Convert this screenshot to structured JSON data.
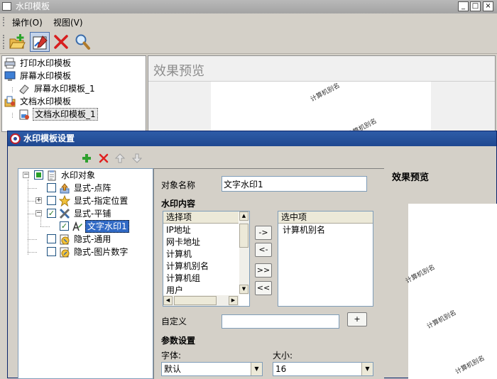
{
  "main_window": {
    "title": "水印模板",
    "controls": {
      "minimize": "_",
      "maximize": "□",
      "close": "×"
    }
  },
  "menu": {
    "items": [
      {
        "label": "操作(O)"
      },
      {
        "label": "视图(V)"
      }
    ]
  },
  "toolbar": {
    "buttons": [
      {
        "icon": "open-folder-add-icon"
      },
      {
        "icon": "edit-template-icon",
        "active": true
      },
      {
        "icon": "delete-x-icon"
      },
      {
        "icon": "magnifier-search-icon"
      }
    ]
  },
  "template_tree": {
    "items": [
      {
        "label": "打印水印模板",
        "icon": "printer-icon"
      },
      {
        "label": "屏幕水印模板",
        "icon": "monitor-icon"
      },
      {
        "label": "屏幕水印模板_1",
        "icon": "eraser-template-icon"
      },
      {
        "label": "文档水印模板",
        "icon": "document-folder-icon"
      },
      {
        "label": "文档水印模板_1",
        "icon": "document-template-icon",
        "selected": true
      }
    ]
  },
  "main_preview": {
    "header": "效果预览",
    "watermarks": [
      "计算机别名",
      "计算机别名"
    ]
  },
  "dialog": {
    "title": "水印模板设置",
    "toolbar_icons": [
      "add-green-plus-icon",
      "delete-red-x-icon",
      "move-up-arrow-icon",
      "move-down-arrow-icon"
    ],
    "object_tree": {
      "root": {
        "label": "水印对象"
      },
      "children": [
        {
          "label": "显式-点阵",
          "checked": false
        },
        {
          "label": "显式-指定位置",
          "checked": false,
          "expandable": true
        },
        {
          "label": "显式-平铺",
          "checked": true,
          "expanded": true
        },
        {
          "label": "文字水印1",
          "checked": true,
          "selected": true
        },
        {
          "label": "隐式-通用",
          "checked": false
        },
        {
          "label": "隐式-图片数字",
          "checked": false
        }
      ]
    },
    "object_name_label": "对象名称",
    "object_name_value": "文字水印1",
    "watermark_content_label": "水印内容",
    "available_list": {
      "header": "选择项",
      "items": [
        "IP地址",
        "网卡地址",
        "计算机",
        "计算机别名",
        "计算机组",
        "用户"
      ]
    },
    "move_buttons": [
      "->",
      "<-",
      ">>",
      "<<"
    ],
    "selected_list": {
      "header": "选中项",
      "items": [
        "计算机别名"
      ]
    },
    "custom_label": "自定义",
    "custom_value": "",
    "custom_add_button": "+",
    "param_settings_label": "参数设置",
    "font_label": "字体:",
    "font_value": "默认",
    "size_label": "大小:",
    "size_value": "16",
    "preview_title": "效果预览",
    "preview_watermarks": [
      "计算机别名",
      "计算机别名",
      "计算机别名"
    ]
  }
}
